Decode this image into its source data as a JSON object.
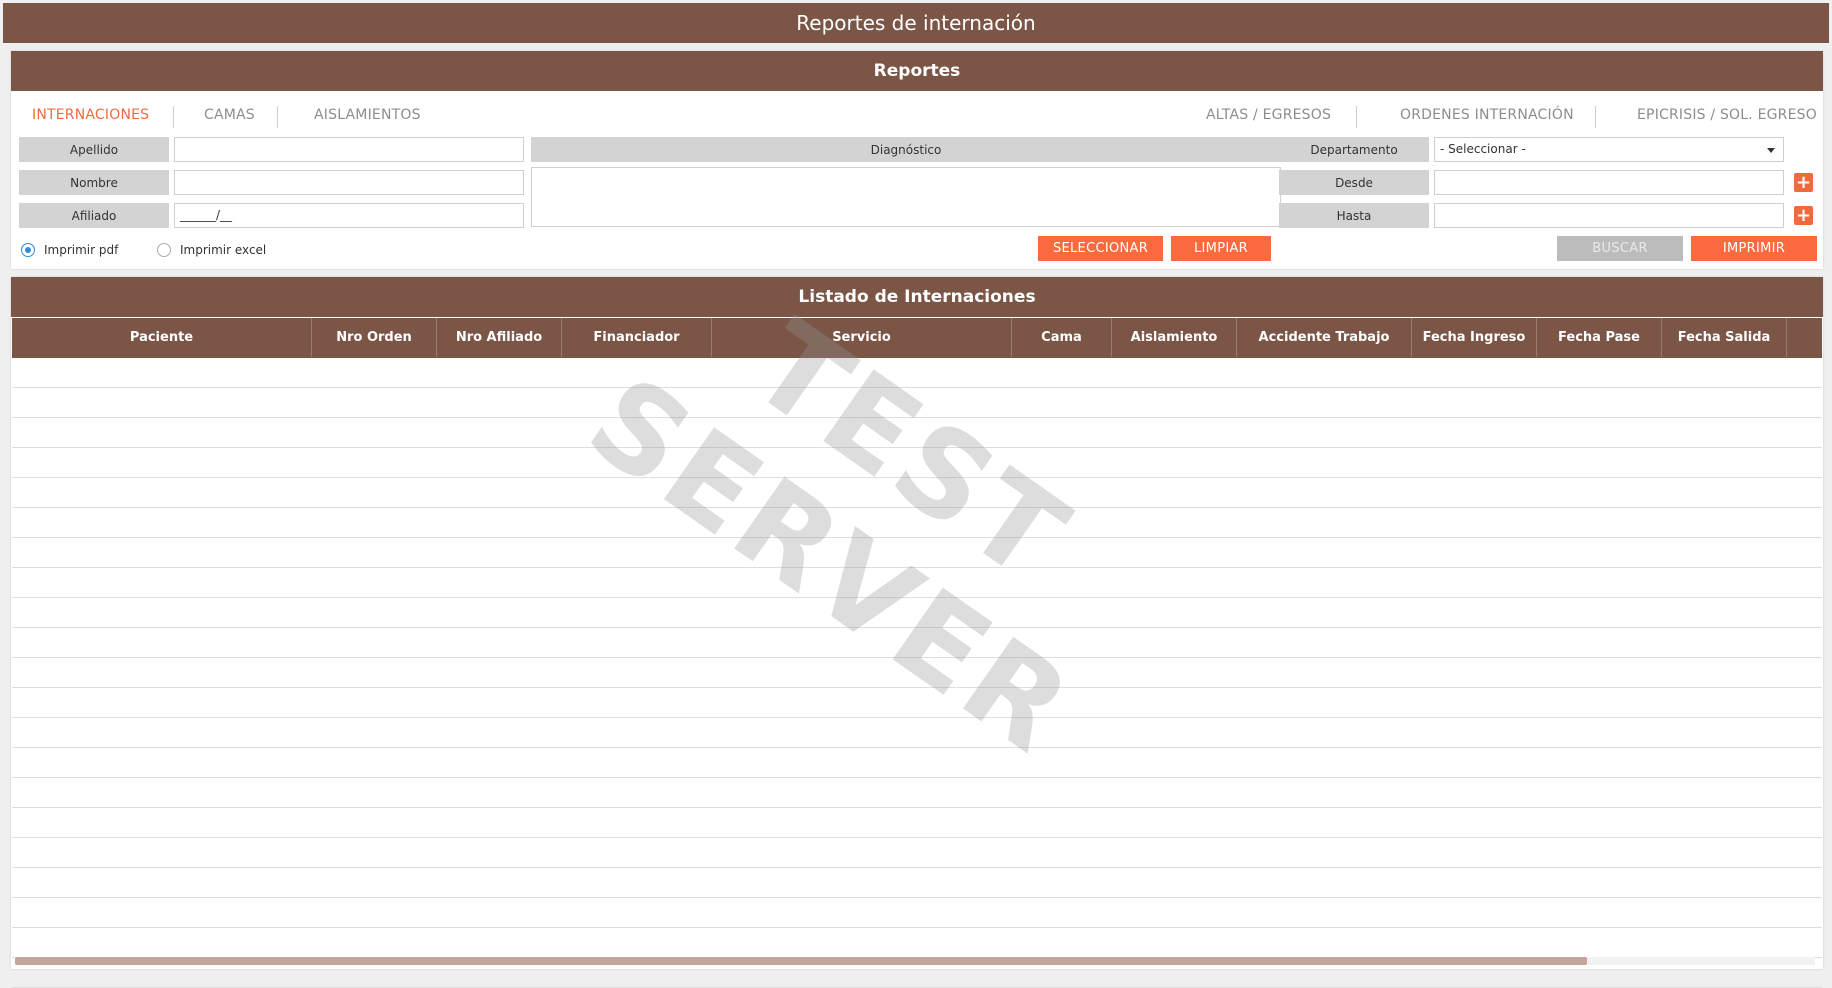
{
  "window": {
    "title": "Reportes de internación"
  },
  "reportes_panel": {
    "title": "Reportes",
    "tabs_left": [
      "INTERNACIONES",
      "CAMAS",
      "AISLAMIENTOS"
    ],
    "tabs_right": [
      "ALTAS / EGRESOS",
      "ORDENES INTERNACIÓN",
      "EPICRISIS / SOL. EGRESO"
    ],
    "active_tab": "INTERNACIONES",
    "form": {
      "apellido_label": "Apellido",
      "apellido_value": "",
      "nombre_label": "Nombre",
      "nombre_value": "",
      "afiliado_label": "Afiliado",
      "afiliado_value": "______/__",
      "diagnostico_label": "Diagnóstico",
      "diagnostico_value": "",
      "departamento_label": "Departamento",
      "departamento_selected": "- Seleccionar -",
      "desde_label": "Desde",
      "desde_value": "",
      "hasta_label": "Hasta",
      "hasta_value": "",
      "radio_pdf": "Imprimir pdf",
      "radio_excel": "Imprimir excel",
      "radio_selected": "pdf"
    },
    "buttons": {
      "seleccionar": "SELECCIONAR",
      "limpiar": "LIMPIAR",
      "buscar": "BUSCAR",
      "imprimir": "IMPRIMIR"
    }
  },
  "listado_panel": {
    "title": "Listado de Internaciones",
    "columns": [
      "Paciente",
      "Nro Orden",
      "Nro Afiliado",
      "Financiador",
      "Servicio",
      "Cama",
      "Aislamiento",
      "Accidente Trabajo",
      "Fecha Ingreso",
      "Fecha Pase",
      "Fecha Salida"
    ]
  },
  "watermark": "TEST SERVER",
  "colors": {
    "brand_brown": "#7b5647",
    "accent_orange": "#fb6a3f",
    "radio_blue": "#2d8ae0"
  }
}
